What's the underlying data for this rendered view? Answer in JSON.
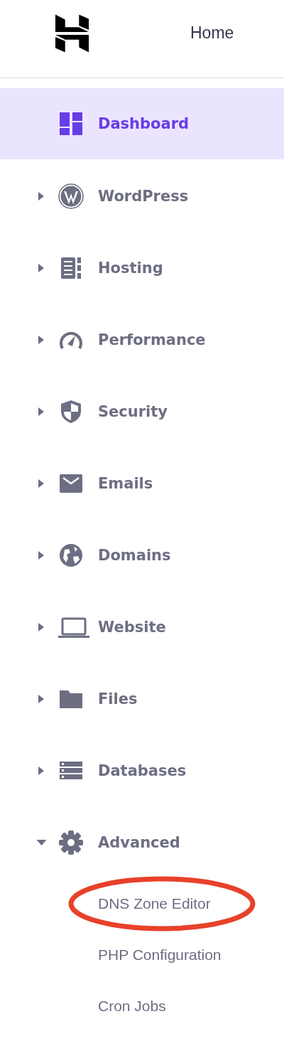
{
  "header": {
    "title": "Home"
  },
  "items": [
    {
      "kind": "link",
      "label": "Dashboard",
      "selected": true
    },
    {
      "kind": "group",
      "label": "WordPress",
      "selected": false,
      "expanded": false
    },
    {
      "kind": "group",
      "label": "Hosting",
      "selected": false,
      "expanded": false
    },
    {
      "kind": "group",
      "label": "Performance",
      "selected": false,
      "expanded": false
    },
    {
      "kind": "group",
      "label": "Security",
      "selected": false,
      "expanded": false
    },
    {
      "kind": "group",
      "label": "Emails",
      "selected": false,
      "expanded": false
    },
    {
      "kind": "group",
      "label": "Domains",
      "selected": false,
      "expanded": false
    },
    {
      "kind": "group",
      "label": "Website",
      "selected": false,
      "expanded": false
    },
    {
      "kind": "group",
      "label": "Files",
      "selected": false,
      "expanded": false
    },
    {
      "kind": "group",
      "label": "Databases",
      "selected": false,
      "expanded": false
    },
    {
      "kind": "group",
      "label": "Advanced",
      "selected": false,
      "expanded": true,
      "children": [
        {
          "label": "DNS Zone Editor",
          "highlighted": true
        },
        {
          "label": "PHP Configuration"
        },
        {
          "label": "Cron Jobs"
        }
      ]
    }
  ]
}
